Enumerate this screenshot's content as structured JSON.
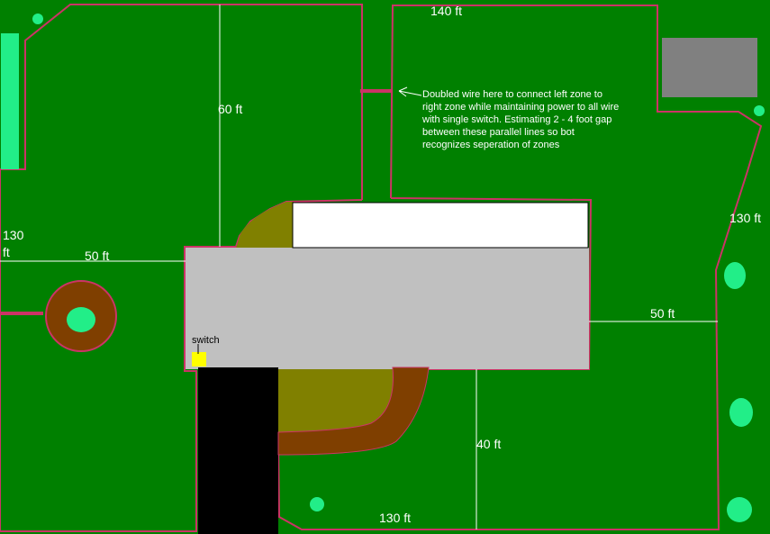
{
  "colors": {
    "lawn": "#008000",
    "boundary_wire": "#cc3366",
    "house": "#c0c0c0",
    "patio": "#ffffff",
    "driveway": "#000000",
    "shed": "#808080",
    "mulch": "#7f3f00",
    "olive_bed": "#808000",
    "shrub": "#22ee88",
    "switch": "#ffff00",
    "dimension_line": "#ffffff"
  },
  "labels": {
    "dim_top": "140 ft",
    "dim_left_upper": "60 ft",
    "dim_left_130_line1": "130",
    "dim_left_130_line2": "ft",
    "dim_left_50": "50 ft",
    "dim_right_130": "130 ft",
    "dim_right_50": "50 ft",
    "dim_bottom_40": "40 ft",
    "dim_bottom_130": "130 ft",
    "switch": "switch"
  },
  "annotation": {
    "lines": [
      "Doubled wire here to connect left zone to",
      "right zone while maintaining power to all wire",
      "with single switch. Estimating 2 - 4 foot gap",
      "between these parallel lines so bot",
      "recognizes seperation of zones"
    ]
  }
}
